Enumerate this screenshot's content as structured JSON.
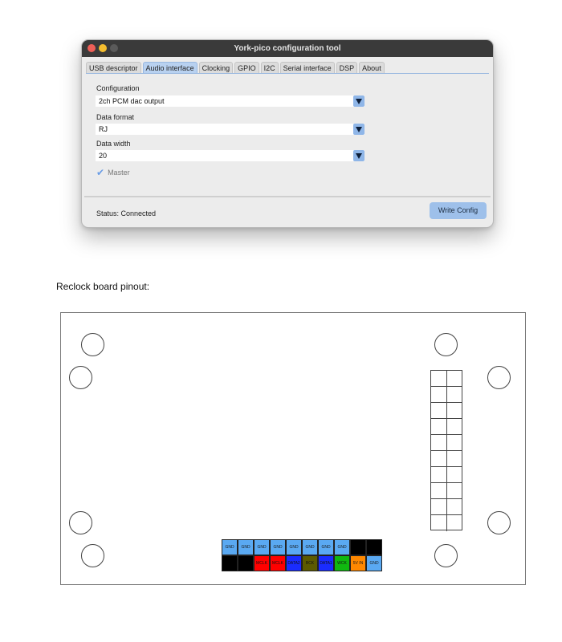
{
  "window": {
    "title": "York-pico configuration tool",
    "tabs": [
      "USB descriptor",
      "Audio interface",
      "Clocking",
      "GPIO",
      "I2C",
      "Serial interface",
      "DSP",
      "About"
    ],
    "active_tab": "Audio interface"
  },
  "audio": {
    "configuration_label": "Configuration",
    "configuration_value": "2ch PCM dac output",
    "data_format_label": "Data format",
    "data_format_value": "RJ",
    "data_width_label": "Data width",
    "data_width_value": "20",
    "master_label": "Master",
    "master_checked": true
  },
  "status": {
    "text": "Status: Connected"
  },
  "buttons": {
    "write_config": "Write Config"
  },
  "pinout": {
    "caption": "Reclock board pinout:",
    "top_row": [
      {
        "label": "GND",
        "color": "#5aa9f2"
      },
      {
        "label": "GND",
        "color": "#5aa9f2"
      },
      {
        "label": "GND",
        "color": "#5aa9f2"
      },
      {
        "label": "GND",
        "color": "#5aa9f2"
      },
      {
        "label": "GND",
        "color": "#5aa9f2"
      },
      {
        "label": "GND",
        "color": "#5aa9f2"
      },
      {
        "label": "GND",
        "color": "#5aa9f2"
      },
      {
        "label": "GND",
        "color": "#5aa9f2"
      },
      {
        "label": "",
        "color": "#000000"
      },
      {
        "label": "",
        "color": "#000000"
      }
    ],
    "bottom_row": [
      {
        "label": "",
        "color": "#000000"
      },
      {
        "label": "",
        "color": "#000000"
      },
      {
        "label": "MCLK",
        "color": "#ff0000"
      },
      {
        "label": "MCLK",
        "color": "#ff0000"
      },
      {
        "label": "DATA2",
        "color": "#1a2cff"
      },
      {
        "label": "BCK",
        "color": "#5c5a00"
      },
      {
        "label": "DATA1",
        "color": "#1a2cff"
      },
      {
        "label": "WCK",
        "color": "#10b810"
      },
      {
        "label": "5V IN",
        "color": "#ff8800"
      },
      {
        "label": "GND",
        "color": "#5aa9f2"
      }
    ]
  }
}
